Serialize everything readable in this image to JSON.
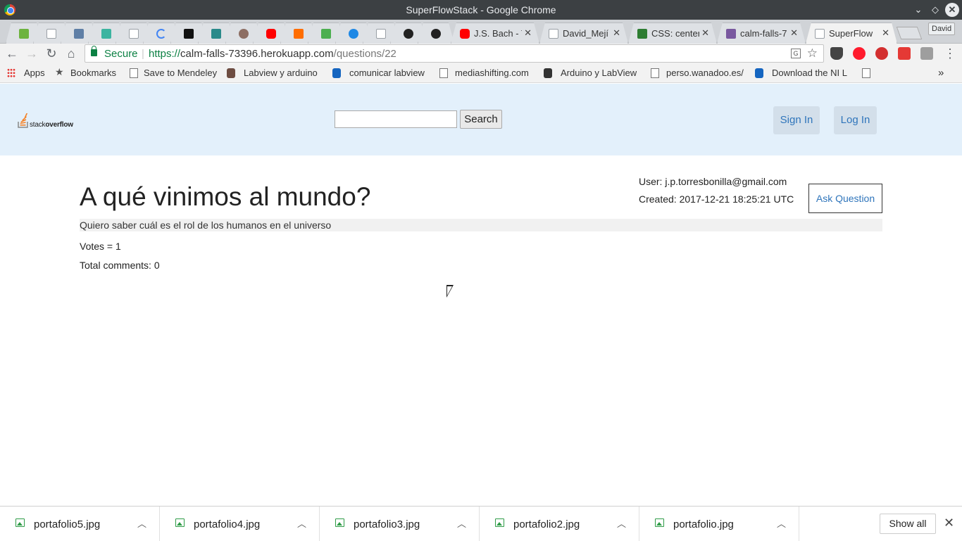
{
  "window": {
    "title": "SuperFlowStack - Google Chrome"
  },
  "tabs": [
    {
      "label": "",
      "icon": "leaf-icon",
      "color": "#6db33f"
    },
    {
      "label": "",
      "icon": "page-icon",
      "color": "#9aa0a6"
    },
    {
      "label": "",
      "icon": "tiles-icon",
      "color": "#5f7fa6"
    },
    {
      "label": "",
      "icon": "code-icon",
      "color": "#3cb4a0"
    },
    {
      "label": "",
      "icon": "page-icon",
      "color": "#9aa0a6"
    },
    {
      "label": "",
      "icon": "loading-icon",
      "color": "#4285f4"
    },
    {
      "label": "",
      "icon": "medium-icon",
      "color": "#111111"
    },
    {
      "label": "",
      "icon": "atom-icon",
      "color": "#2a8a8a"
    },
    {
      "label": "",
      "icon": "avatar-icon",
      "color": "#8d6e63"
    },
    {
      "label": "",
      "icon": "youtube-icon",
      "color": "#ff0000"
    },
    {
      "label": "",
      "icon": "asterisk-icon",
      "color": "#ff6d00"
    },
    {
      "label": "",
      "icon": "mountain-icon",
      "color": "#4caf50"
    },
    {
      "label": "",
      "icon": "seal-icon",
      "color": "#1e88e5"
    },
    {
      "label": "",
      "icon": "page-icon",
      "color": "#9aa0a6"
    },
    {
      "label": "",
      "icon": "github-icon",
      "color": "#222222"
    },
    {
      "label": "",
      "icon": "github-icon",
      "color": "#222222"
    },
    {
      "label": "J.S. Bach - T",
      "icon": "youtube-icon",
      "color": "#ff0000"
    },
    {
      "label": "David_Mejí",
      "icon": "page-icon",
      "color": "#9aa0a6"
    },
    {
      "label": "CSS: center",
      "icon": "w3schools-icon",
      "color": "#2e7d32"
    },
    {
      "label": "calm-falls-7",
      "icon": "heroku-icon",
      "color": "#79589f"
    },
    {
      "label": "SuperFlow",
      "icon": "page-icon",
      "color": "#9aa0a6"
    }
  ],
  "profile": "David",
  "address": {
    "secure_label": "Secure",
    "scheme": "https://",
    "host": "calm-falls-73396.herokuapp.com",
    "path": "/questions/22"
  },
  "bookmarks": [
    {
      "label": "Apps",
      "icon": "apps-grid-icon"
    },
    {
      "label": "Bookmarks",
      "icon": "star-icon"
    },
    {
      "label": "Save to Mendeley",
      "icon": "page-icon"
    },
    {
      "label": "Labview y arduino",
      "icon": "robot-icon"
    },
    {
      "label": "comunicar labview",
      "icon": "ni-eagle-icon"
    },
    {
      "label": "mediashifting.com",
      "icon": "page-icon"
    },
    {
      "label": "Arduino y LabView",
      "icon": "lv-icon"
    },
    {
      "label": "perso.wanadoo.es/",
      "icon": "page-icon"
    },
    {
      "label": "Download the NI L",
      "icon": "ni-eagle-icon"
    }
  ],
  "site": {
    "logo_light": "stack",
    "logo_bold": "overflow",
    "search_button": "Search",
    "sign_in": "Sign In",
    "log_in": "Log In"
  },
  "question": {
    "title": "A qué vinimos al mundo?",
    "user": "User: j.p.torresbonilla@gmail.com",
    "created": "Created: 2017-12-21 18:25:21 UTC",
    "ask_button": "Ask Question",
    "body": "Quiero saber cuál es el rol de los humanos en el universo",
    "votes": "Votes = 1",
    "comments": "Total comments: 0"
  },
  "downloads": [
    {
      "name": "portafolio5.jpg"
    },
    {
      "name": "portafolio4.jpg"
    },
    {
      "name": "portafolio3.jpg"
    },
    {
      "name": "portafolio2.jpg"
    },
    {
      "name": "portafolio.jpg"
    }
  ],
  "downloads_show_all": "Show all"
}
